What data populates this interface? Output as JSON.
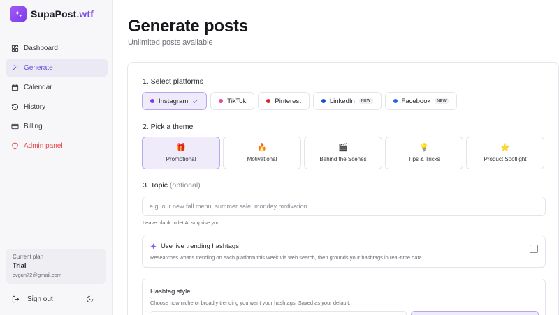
{
  "brand": {
    "name": "SupaPost",
    "suffix": ".wtf"
  },
  "sidebar": {
    "items": [
      {
        "label": "Dashboard",
        "icon": "dashboard-grid-icon"
      },
      {
        "label": "Generate",
        "icon": "magic-wand-icon",
        "active": true
      },
      {
        "label": "Calendar",
        "icon": "calendar-icon"
      },
      {
        "label": "History",
        "icon": "history-icon"
      },
      {
        "label": "Billing",
        "icon": "credit-card-icon"
      },
      {
        "label": "Admin panel",
        "icon": "shield-icon",
        "danger": true
      }
    ],
    "plan": {
      "label": "Current plan",
      "name": "Trial",
      "email": "cvgun72@gmail.com"
    },
    "signout_label": "Sign out"
  },
  "page": {
    "title": "Generate posts",
    "subtitle": "Unlimited posts available"
  },
  "platforms": {
    "heading": "1. Select platforms",
    "items": [
      {
        "label": "Instagram",
        "color": "#7c3aed",
        "selected": true
      },
      {
        "label": "TikTok",
        "color": "#ec4899"
      },
      {
        "label": "Pinterest",
        "color": "#dc2626"
      },
      {
        "label": "LinkedIn",
        "color": "#1d4ed8",
        "badge": "NEW"
      },
      {
        "label": "Facebook",
        "color": "#2563eb",
        "badge": "NEW"
      }
    ]
  },
  "themes": {
    "heading": "2. Pick a theme",
    "items": [
      {
        "label": "Promotional",
        "icon": "🎁",
        "selected": true
      },
      {
        "label": "Motivational",
        "icon": "🔥"
      },
      {
        "label": "Behind the Scenes",
        "icon": "🎬"
      },
      {
        "label": "Tips & Tricks",
        "icon": "💡"
      },
      {
        "label": "Product Spotlight",
        "icon": "⭐"
      }
    ]
  },
  "topic": {
    "heading": "3. Topic",
    "optional": "(optional)",
    "value": "",
    "placeholder": "e.g. our new fall menu, summer sale, monday motivation...",
    "hint": "Leave blank to let AI surprise you."
  },
  "trending": {
    "title": "Use live trending hashtags",
    "description": "Researches what's trending on each platform this week via web search, then grounds your hashtags in real-time data.",
    "checked": false
  },
  "hashtag_style": {
    "title": "Hashtag style",
    "description": "Choose how niche or broadly trending you want your hashtags. Saved as your default."
  },
  "colors": {
    "accent": "#7c3aed",
    "danger": "#e5484d",
    "selected_bg": "#efebfb"
  }
}
